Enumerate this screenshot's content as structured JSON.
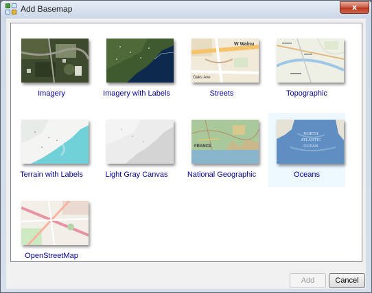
{
  "window": {
    "title": "Add Basemap",
    "close_glyph": "x"
  },
  "basemaps": [
    {
      "label": "Imagery",
      "icon": "imagery-thumbnail",
      "selected": false
    },
    {
      "label": "Imagery with Labels",
      "icon": "imagery-with-labels-thumbnail",
      "selected": false
    },
    {
      "label": "Streets",
      "icon": "streets-thumbnail",
      "selected": false,
      "map_text": [
        "W Walnu",
        "Oaks Ave"
      ]
    },
    {
      "label": "Topographic",
      "icon": "topographic-thumbnail",
      "selected": false
    },
    {
      "label": "Terrain with Labels",
      "icon": "terrain-thumbnail",
      "selected": false
    },
    {
      "label": "Light Gray Canvas",
      "icon": "light-gray-canvas-thumbnail",
      "selected": false
    },
    {
      "label": "National Geographic",
      "icon": "national-geographic-thumbnail",
      "selected": false,
      "map_text": [
        "FRANCE"
      ]
    },
    {
      "label": "Oceans",
      "icon": "oceans-thumbnail",
      "selected": true,
      "map_text": [
        "NORTH",
        "ATLANTIC",
        "OCEAN"
      ]
    },
    {
      "label": "OpenStreetMap",
      "icon": "openstreetmap-thumbnail",
      "selected": false
    }
  ],
  "buttons": {
    "add": "Add",
    "cancel": "Cancel"
  },
  "colors": {
    "label_text": "#000099",
    "selection_bg": "#ecf7ff",
    "close_button": "#c75a3f"
  }
}
